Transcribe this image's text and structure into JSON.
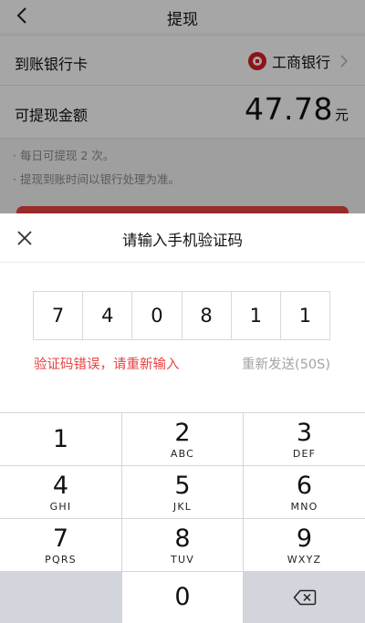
{
  "nav": {
    "title": "提现",
    "back_icon": "chevron-left-icon"
  },
  "bank_row": {
    "label": "到账银行卡",
    "bank_name": "工商银行",
    "bank_logo": "icbc-logo",
    "color_logo": "#d71f26"
  },
  "amount_row": {
    "label": "可提现金额",
    "amount": "47.78",
    "unit": "元"
  },
  "notes": [
    "· 每日可提现 2 次。",
    "· 提现到账时间以银行处理为准。"
  ],
  "sheet": {
    "title": "请输入手机验证码",
    "close_icon": "close-icon",
    "code": [
      "7",
      "4",
      "0",
      "8",
      "1",
      "1"
    ],
    "error_text": "验证码错误，请重新输入",
    "resend_text": "重新发送(50S)",
    "colors": {
      "error": "#e8423f",
      "muted": "#a3a3a3",
      "accent": "#e8423f"
    }
  },
  "keypad": {
    "keys": [
      {
        "digit": "1",
        "letters": ""
      },
      {
        "digit": "2",
        "letters": "ABC"
      },
      {
        "digit": "3",
        "letters": "DEF"
      },
      {
        "digit": "4",
        "letters": "GHI"
      },
      {
        "digit": "5",
        "letters": "JKL"
      },
      {
        "digit": "6",
        "letters": "MNO"
      },
      {
        "digit": "7",
        "letters": "PQRS"
      },
      {
        "digit": "8",
        "letters": "TUV"
      },
      {
        "digit": "9",
        "letters": "WXYZ"
      },
      {
        "digit": "0",
        "letters": ""
      }
    ],
    "delete_icon": "backspace-icon"
  }
}
